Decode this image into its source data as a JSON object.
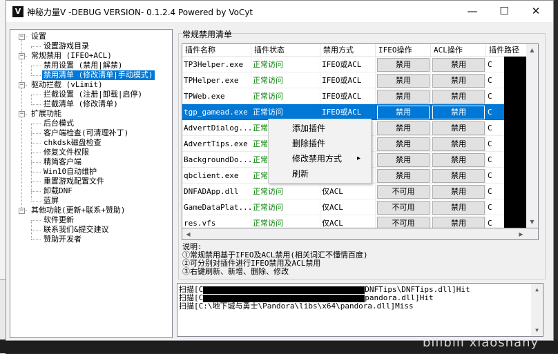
{
  "window": {
    "title": "神秘力量V -DEBUG VERSION- 0.1.2.4  Powered by VoCyt",
    "app_icon": "V",
    "controls": {
      "minimize": "—",
      "maximize": "☐",
      "close": "✕"
    }
  },
  "tree": {
    "items": [
      {
        "label": "设置",
        "expand": "−"
      },
      {
        "label": "设置游戏目录"
      },
      {
        "label": "常规禁用 (IFEO+ACL)",
        "expand": "−"
      },
      {
        "label": "禁用设置 (禁用|解禁)"
      },
      {
        "label": "禁用清单 (修改清单|手动模式)",
        "selected": true
      },
      {
        "label": "驱动拦截 (vLimit)",
        "expand": "−"
      },
      {
        "label": "拦截设置 (注册|卸载|启停)"
      },
      {
        "label": "拦截清单 (修改清单)"
      },
      {
        "label": "扩展功能",
        "expand": "−"
      },
      {
        "label": "后台模式"
      },
      {
        "label": "客户端检查(可清理补丁)"
      },
      {
        "label": "chkdsk磁盘检查"
      },
      {
        "label": "修复文件权限"
      },
      {
        "label": "精简客户端"
      },
      {
        "label": "Win10自动维护"
      },
      {
        "label": "重置游戏配置文件"
      },
      {
        "label": "卸载DNF"
      },
      {
        "label": "蓝屏"
      },
      {
        "label": "其他功能(更新+联系+赞助)",
        "expand": "−"
      },
      {
        "label": "软件更新"
      },
      {
        "label": "联系我们&提交建议"
      },
      {
        "label": "赞助开发者"
      }
    ]
  },
  "list": {
    "group_title": "常规禁用清单",
    "columns": [
      "插件名称",
      "插件状态",
      "禁用方式",
      "IFEO操作",
      "ACL操作",
      "插件路径"
    ],
    "rows": [
      {
        "name": "TP3Helper.exe",
        "status": "正常访问",
        "mode": "IFEO或ACL",
        "ifeo": "禁用",
        "acl": "禁用",
        "path": "C"
      },
      {
        "name": "TPHelper.exe",
        "status": "正常访问",
        "mode": "IFEO或ACL",
        "ifeo": "禁用",
        "acl": "禁用",
        "path": "C"
      },
      {
        "name": "TPWeb.exe",
        "status": "正常访问",
        "mode": "IFEO或ACL",
        "ifeo": "禁用",
        "acl": "禁用",
        "path": "C"
      },
      {
        "name": "tgp_gamead.exe",
        "status": "正常访问",
        "mode": "IFEO或ACL",
        "ifeo": "禁用",
        "acl": "禁用",
        "path": "C",
        "selected": true
      },
      {
        "name": "AdvertDialog...",
        "status": "正常",
        "mode": "",
        "ifeo": "禁用",
        "acl": "禁用",
        "path": "C"
      },
      {
        "name": "AdvertTips.exe",
        "status": "正常",
        "mode": "",
        "ifeo": "禁用",
        "acl": "禁用",
        "path": "C"
      },
      {
        "name": "BackgroundDo...",
        "status": "正常",
        "mode": "",
        "ifeo": "禁用",
        "acl": "禁用",
        "path": "C"
      },
      {
        "name": "qbclient.exe",
        "status": "正常",
        "mode": "",
        "ifeo": "禁用",
        "acl": "禁用",
        "path": "C"
      },
      {
        "name": "DNFADApp.dll",
        "status": "正常访问",
        "mode": "仅ACL",
        "ifeo": "不可用",
        "acl": "禁用",
        "path": "C"
      },
      {
        "name": "GameDataPlat...",
        "status": "正常访问",
        "mode": "仅ACL",
        "ifeo": "不可用",
        "acl": "禁用",
        "path": "C"
      },
      {
        "name": "res.vfs",
        "status": "正常访问",
        "mode": "仅ACL",
        "ifeo": "不可用",
        "acl": "禁用",
        "path": "C"
      }
    ]
  },
  "context_menu": {
    "items": [
      "添加插件",
      "删除插件",
      "修改禁用方式",
      "刷新"
    ],
    "submenu_arrow": "▸"
  },
  "notes": [
    "说明:",
    "①常规禁用基于IFEO及ACL禁用(相关词汇不懂情百度)",
    "②可分别对插件进行IFEO禁用及ACL禁用",
    "③右键刷新、新增、删除、修改"
  ],
  "log": [
    {
      "prefix": "扫描[C",
      "suffix": "DNFTips\\DNFTips.dll]Hit"
    },
    {
      "prefix": "扫描[C",
      "suffix": "pandora.dll]Hit"
    },
    {
      "prefix": "扫描[C:\\地下城与勇士\\Pandora\\libs\\x64\\pandora.dll]Miss",
      "suffix": ""
    }
  ],
  "watermark": "bilibili xiaoshany",
  "colors": {
    "selection": "#0078d7",
    "status_green": "#008000"
  }
}
